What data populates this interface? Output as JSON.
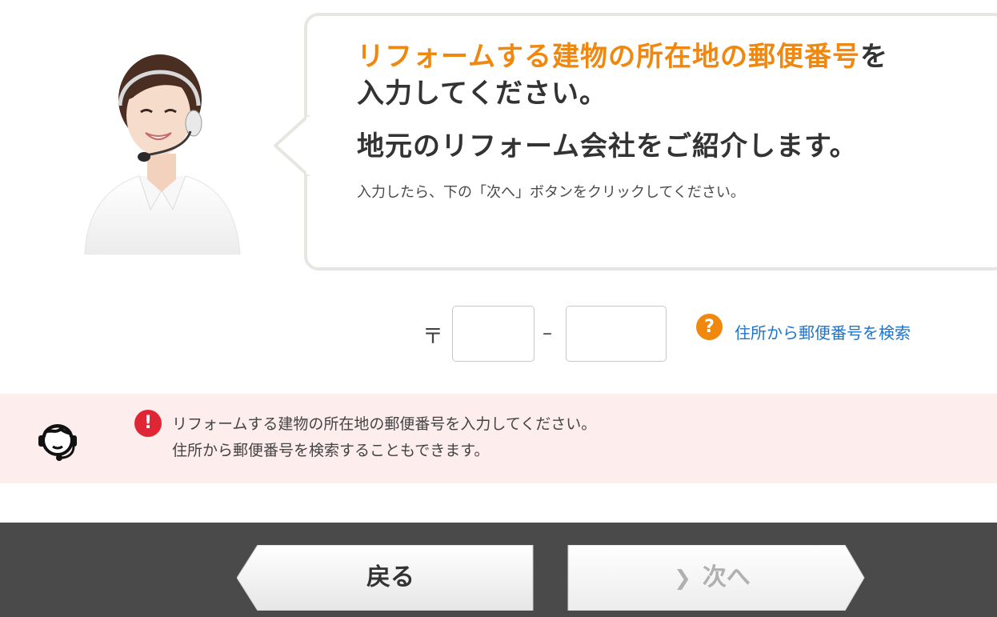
{
  "headline": {
    "accent": "リフォームする建物の所在地の郵便番号",
    "rest_line1": "を",
    "line2": "入力してください。"
  },
  "subhead": "地元のリフォーム会社をご紹介します。",
  "instruction": "入力したら、下の「次へ」ボタンをクリックしてください。",
  "postal": {
    "mark": "〒",
    "dash": "–",
    "zip1_value": "",
    "zip2_value": "",
    "help_icon": "question-icon",
    "search_link": "住所から郵便番号を検索"
  },
  "banner": {
    "support_icon": "headset-operator-icon",
    "error_icon": "exclamation-icon",
    "line1": "リフォームする建物の所在地の郵便番号を入力してください。",
    "line2": "住所から郵便番号を検索することもできます。"
  },
  "footer": {
    "back_label": "戻る",
    "next_label": "次へ",
    "next_icon": "chevron-right-icon"
  },
  "colors": {
    "accent": "#f0870f",
    "link": "#1f73c8",
    "error": "#e02534",
    "banner_bg": "#fdeded",
    "footer_bg": "#4a4a4a"
  }
}
